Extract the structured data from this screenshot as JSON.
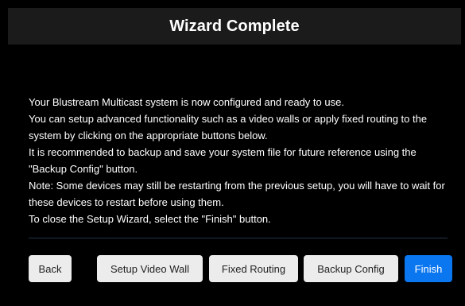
{
  "dialog": {
    "title": "Wizard Complete",
    "message_lines": [
      "Your Blustream Multicast system is now configured and ready to use.",
      "You can setup advanced functionality such as a video walls or apply fixed routing to the system by clicking on the appropriate buttons below.",
      "It is recommended to backup and save your system file for future reference using the \"Backup Config\" button.",
      "Note: Some devices may still be restarting from the previous setup, you will have to wait for these devices to restart before using them.",
      "To close the Setup Wizard, select the \"Finish\" button."
    ]
  },
  "buttons": {
    "back": "Back",
    "setup_video_wall": "Setup Video Wall",
    "fixed_routing": "Fixed Routing",
    "backup_config": "Backup Config",
    "finish": "Finish"
  },
  "colors": {
    "background": "#000000",
    "title_bar": "#1b1b1b",
    "primary_button": "#0a76f0",
    "secondary_button": "#ececec",
    "divider": "#263348"
  }
}
